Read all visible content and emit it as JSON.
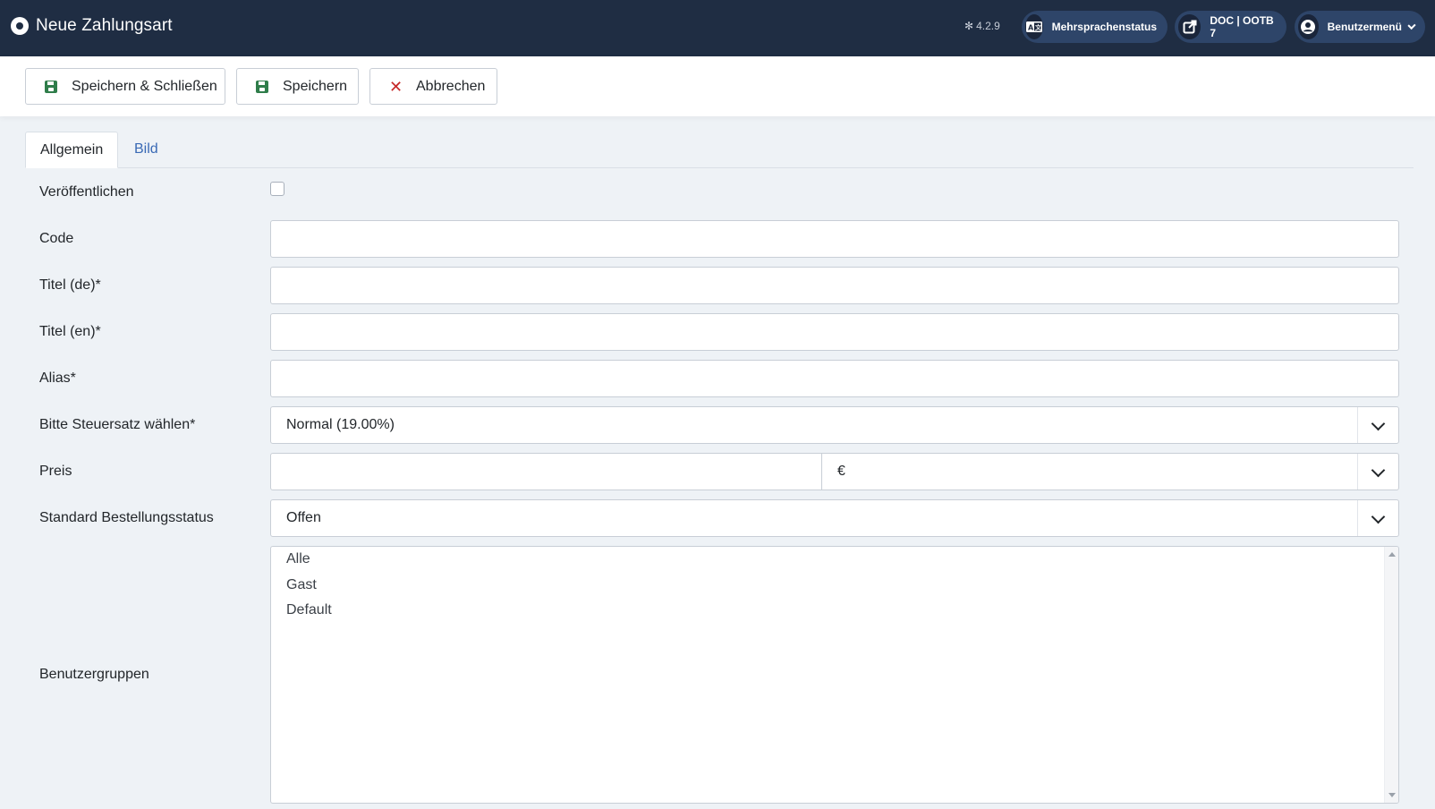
{
  "header": {
    "title": "Neue Zahlungsart",
    "version": "4.2.9",
    "multilang_label": "Mehrsprachenstatus",
    "site_label": "DOC | OOTB 7",
    "user_menu_label": "Benutzermenü"
  },
  "toolbar": {
    "save_close_label": "Speichern & Schließen",
    "save_label": "Speichern",
    "cancel_label": "Abbrechen"
  },
  "tabs": [
    {
      "label": "Allgemein",
      "active": true
    },
    {
      "label": "Bild",
      "active": false
    }
  ],
  "form": {
    "publish": {
      "label": "Veröffentlichen",
      "checked": false
    },
    "code": {
      "label": "Code",
      "value": ""
    },
    "title_de": {
      "label": "Titel (de)*",
      "value": ""
    },
    "title_en": {
      "label": "Titel (en)*",
      "value": ""
    },
    "alias": {
      "label": "Alias*",
      "value": ""
    },
    "tax": {
      "label": "Bitte Steuersatz wählen*",
      "value": "Normal (19.00%)"
    },
    "price": {
      "label": "Preis",
      "value": "",
      "currency": "€"
    },
    "order_status": {
      "label": "Standard Bestellungsstatus",
      "value": "Offen"
    },
    "user_groups": {
      "label": "Benutzergruppen",
      "options": [
        "Alle",
        "Gast",
        "Default"
      ]
    }
  },
  "colors": {
    "header_bg": "#1f2d43",
    "pill_bg": "#2e4569",
    "save_icon": "#2f7d4a",
    "cancel_icon": "#c62828",
    "link": "#3a6ab5"
  },
  "icons": {
    "logo": "joomla-dot-icon",
    "version": "joomla-icon",
    "multilang": "language-icon",
    "site": "external-link-icon",
    "user": "user-circle-icon",
    "save": "save-icon",
    "cancel": "close-icon"
  }
}
